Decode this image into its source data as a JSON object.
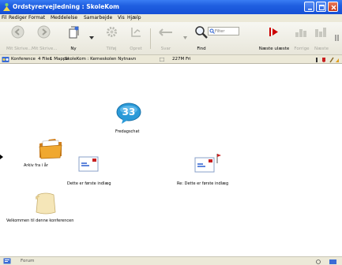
{
  "window": {
    "title": "Ordstyrervejledning : SkoleKom",
    "buttons": [
      "minimize",
      "maximize",
      "close"
    ]
  },
  "menu": {
    "items": [
      "Fil",
      "Rediger",
      "Format",
      "Meddelelse",
      "Samarbejde",
      "Vis",
      "Hjælp"
    ]
  },
  "toolbar": {
    "items": [
      {
        "label": "Mit Skrive...",
        "icon": "back-arrow-icon",
        "enabled": false
      },
      {
        "label": "Mit Skrive...",
        "icon": "forward-arrow-icon",
        "enabled": false
      },
      {
        "label": "Ny",
        "icon": "new-document-icon",
        "enabled": true
      },
      {
        "label": "Tilføj",
        "icon": "gear-icon",
        "enabled": false
      },
      {
        "label": "Opret",
        "icon": "hierarchy-icon",
        "enabled": false
      },
      {
        "label": "Svar",
        "icon": "reply-icon",
        "enabled": false
      },
      {
        "label": "Find",
        "icon": "search-icon",
        "enabled": true
      },
      {
        "label": "Næste ulæste",
        "icon": "next-unread-icon",
        "enabled": true
      },
      {
        "label": "Forrige",
        "icon": "previous-icon",
        "enabled": false
      },
      {
        "label": "Næste",
        "icon": "next-icon",
        "enabled": false
      }
    ],
    "search_placeholder": "Filter"
  },
  "pathbar": {
    "conference": "Konference",
    "files": "4 Filer",
    "folders": "1 Mappe",
    "path": "SkoleKom : Kerneskolen Nytnavn",
    "size": "227M Fri"
  },
  "items": [
    {
      "label": "Fredagschat",
      "type": "chat",
      "count": "33"
    },
    {
      "label": "Arkiv fra i år",
      "type": "folder"
    },
    {
      "label": "Dette er første indlæg",
      "type": "message"
    },
    {
      "label": "Re: Dette er første indlæg",
      "type": "message-flagged"
    },
    {
      "label": "Velkommen til denne konferencen",
      "type": "document"
    }
  ],
  "status": {
    "text": "Forum"
  }
}
